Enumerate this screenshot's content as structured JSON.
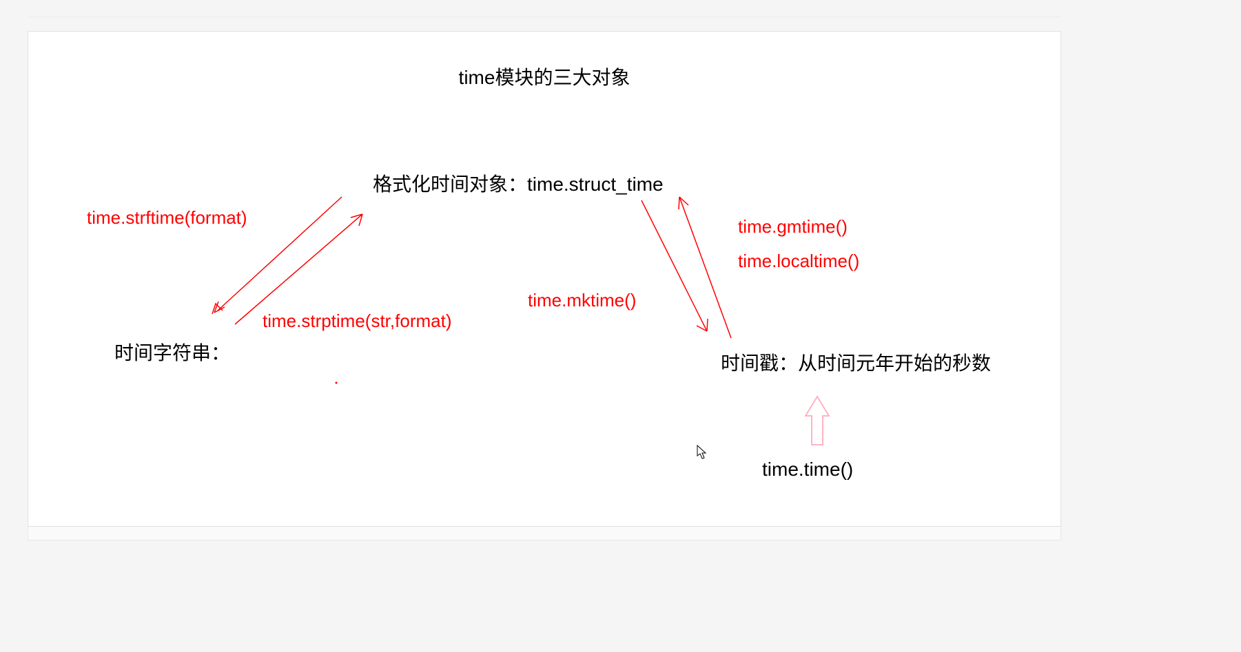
{
  "diagram": {
    "title": "time模块的三大对象",
    "nodes": {
      "struct_time": "格式化时间对象：time.struct_time",
      "time_string": "时间字符串：",
      "timestamp": "时间戳：从时间元年开始的秒数"
    },
    "functions": {
      "strftime": "time.strftime(format)",
      "strptime": "time.strptime(str,format)",
      "mktime": "time.mktime()",
      "gmtime": "time.gmtime()",
      "localtime": "time.localtime()",
      "time": "time.time()"
    },
    "arrows": {
      "color": "#ff0000",
      "up_outline_color": "#ffb3c1"
    }
  }
}
